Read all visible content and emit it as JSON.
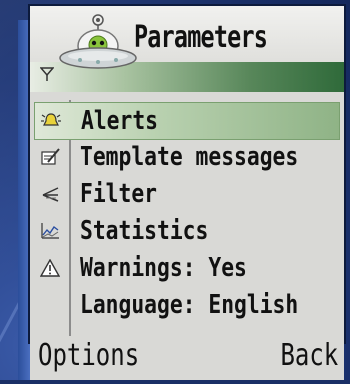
{
  "header": {
    "title": "Parameters",
    "logo_icon": "ufo-alien-icon",
    "signal_icon": "signal-antenna-icon"
  },
  "menu": {
    "selected_index": 0,
    "items": [
      {
        "label": "Alerts",
        "icon": "bell-alert-icon"
      },
      {
        "label": "Template messages",
        "icon": "pencil-note-icon"
      },
      {
        "label": "Filter",
        "icon": "filter-icon"
      },
      {
        "label": "Statistics",
        "icon": "line-chart-icon"
      },
      {
        "label": "Warnings: Yes",
        "icon": "warning-triangle-icon"
      },
      {
        "label": "Language: English",
        "icon": ""
      }
    ]
  },
  "softkeys": {
    "left": "Options",
    "right": "Back"
  },
  "colors": {
    "selection": "#a9c7a0",
    "header_accent": "#2f6a3a",
    "background": "#1f3a78"
  }
}
